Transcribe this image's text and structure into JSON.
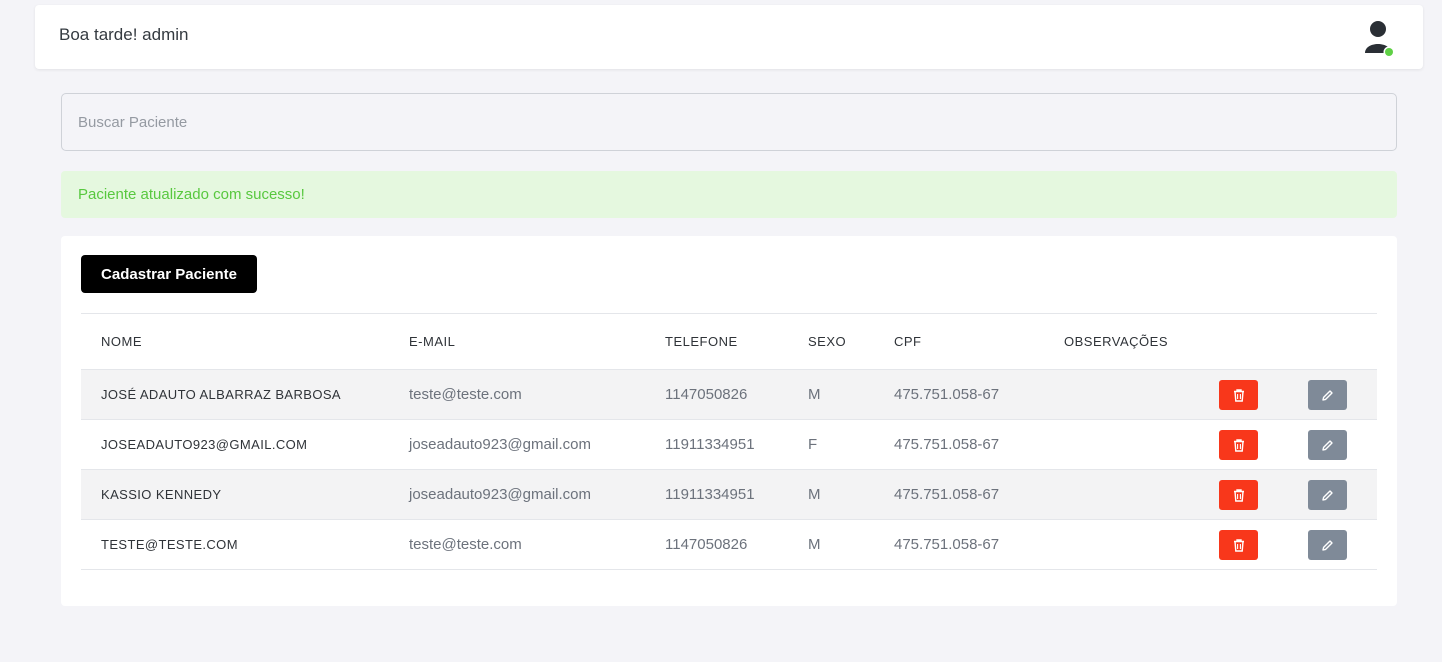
{
  "header": {
    "greeting": "Boa tarde! admin",
    "avatar_icon": "user-icon",
    "status_color": "#5fd045"
  },
  "search": {
    "placeholder": "Buscar Paciente",
    "value": ""
  },
  "alert": {
    "message": "Paciente atualizado com sucesso!"
  },
  "actions": {
    "add_label": "Cadastrar Paciente"
  },
  "table": {
    "columns": [
      "NOME",
      "E-MAIL",
      "TELEFONE",
      "SEXO",
      "CPF",
      "OBSERVAÇÕES"
    ],
    "rows": [
      {
        "nome": "JOSÉ ADAUTO ALBARRAZ BARBOSA",
        "email": "teste@teste.com",
        "telefone": "1147050826",
        "sexo": "M",
        "cpf": "475.751.058-67",
        "obs": ""
      },
      {
        "nome": "JOSEADAUTO923@GMAIL.COM",
        "email": "joseadauto923@gmail.com",
        "telefone": "11911334951",
        "sexo": "F",
        "cpf": "475.751.058-67",
        "obs": ""
      },
      {
        "nome": "KASSIO KENNEDY",
        "email": "joseadauto923@gmail.com",
        "telefone": "11911334951",
        "sexo": "M",
        "cpf": "475.751.058-67",
        "obs": ""
      },
      {
        "nome": "TESTE@TESTE.COM",
        "email": "teste@teste.com",
        "telefone": "1147050826",
        "sexo": "M",
        "cpf": "475.751.058-67",
        "obs": ""
      }
    ],
    "delete_icon": "trash-icon",
    "edit_icon": "pencil-icon"
  },
  "colors": {
    "delete": "#f8371b",
    "edit": "#7f8a98",
    "alert_bg": "#e5f8df",
    "alert_text": "#58c83f"
  }
}
